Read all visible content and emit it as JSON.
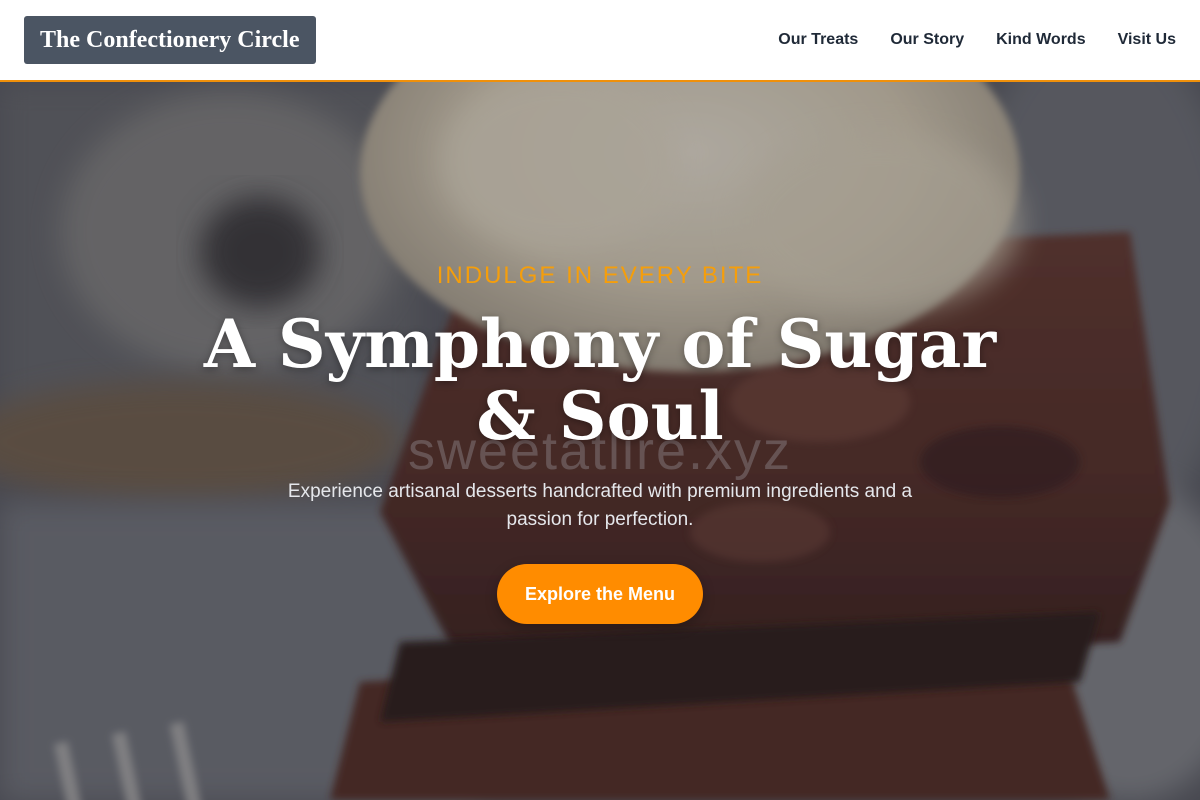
{
  "header": {
    "logo_text": "The Confectionery Circle",
    "nav": [
      {
        "label": "Our Treats"
      },
      {
        "label": "Our Story"
      },
      {
        "label": "Kind Words"
      },
      {
        "label": "Visit Us"
      }
    ]
  },
  "hero": {
    "eyebrow": "INDULGE IN EVERY BITE",
    "title": "A Symphony of Sugar & Soul",
    "subtitle": "Experience artisanal desserts handcrafted with premium ingredients and a passion for perfection.",
    "cta_label": "Explore the Menu",
    "watermark": "sweetatlire.xyz"
  },
  "colors": {
    "accent": "#ff8c00",
    "eyebrow": "#f59e0b",
    "logo_bg": "#4b5563",
    "header_border": "#f0900a"
  }
}
